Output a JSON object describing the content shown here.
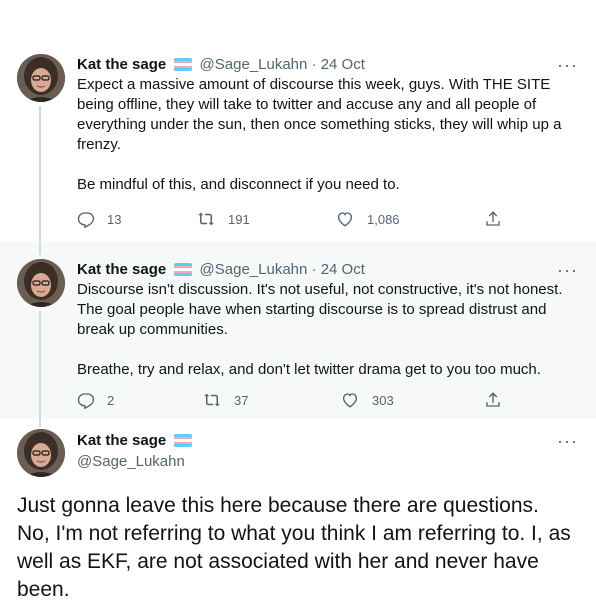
{
  "author": {
    "name": "Kat the sage",
    "handle": "@Sage_Lukahn"
  },
  "colors": {
    "text": "#0f1419",
    "secondary": "#536471",
    "thread_line": "#cfd9de",
    "highlight_bg": "#f7f9f9",
    "flag": [
      "#5bcefa",
      "#f5a9b8",
      "#ffffff",
      "#f5a9b8",
      "#5bcefa"
    ]
  },
  "icons": [
    "more-icon",
    "reply-icon",
    "retweet-icon",
    "like-icon",
    "share-icon",
    "trans-flag-icon"
  ],
  "separator": "·",
  "more_label": "···",
  "tweets": [
    {
      "date": "24 Oct",
      "paragraphs": [
        "Expect a massive amount of discourse this week, guys. With THE SITE being offline, they will take to twitter and accuse any and all people of everything under the sun, then once something sticks, they will whip up a frenzy.",
        "Be mindful of this, and disconnect if you need to."
      ],
      "replies": "13",
      "retweets": "191",
      "likes": "1,086"
    },
    {
      "date": "24 Oct",
      "paragraphs": [
        "Discourse isn't discussion. It's not useful, not constructive, it's not honest. The goal people have when starting discourse is to spread distrust and break up communities.",
        "Breathe, try and relax, and don't let twitter drama get to you too much."
      ],
      "replies": "2",
      "retweets": "37",
      "likes": "303"
    },
    {
      "text": "Just gonna leave this here because there are questions. No, I'm not referring to what you think I am referring to. I, as well as EKF, are not associated with her and never have been."
    }
  ]
}
